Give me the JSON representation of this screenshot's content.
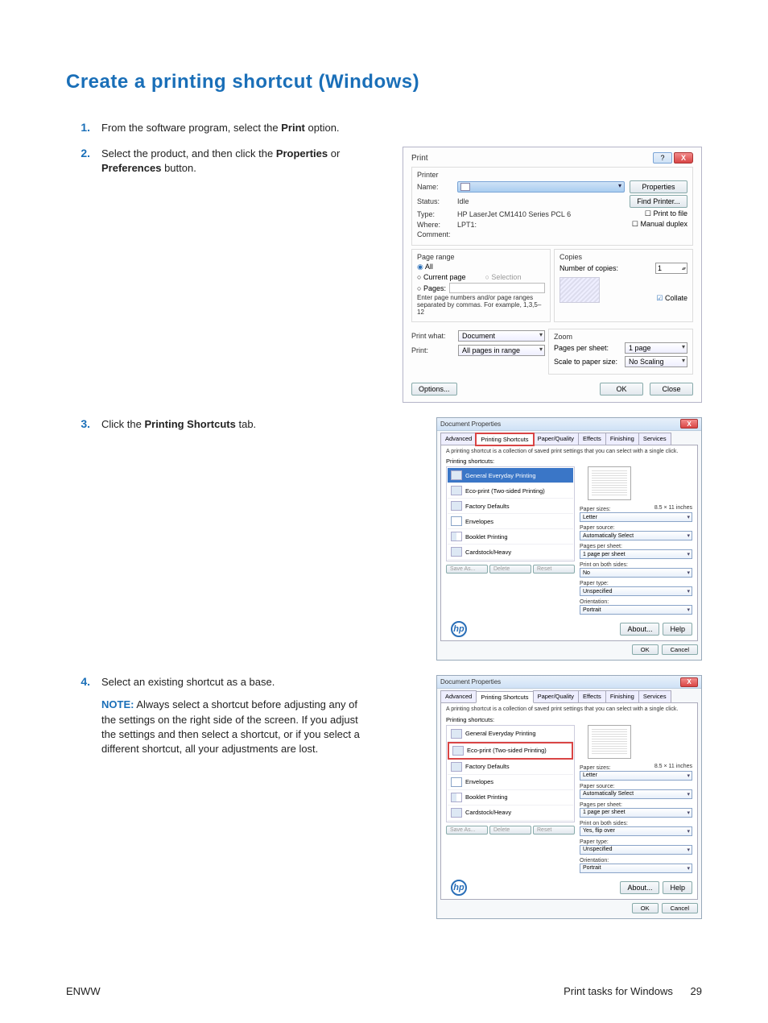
{
  "heading": "Create a printing shortcut (Windows)",
  "steps": {
    "s1": {
      "num": "1.",
      "text_a": "From the software program, select the ",
      "bold_a": "Print",
      "text_b": " option."
    },
    "s2": {
      "num": "2.",
      "text_a": "Select the product, and then click the ",
      "bold_a": "Properties",
      "text_b": " or ",
      "bold_b": "Preferences",
      "text_c": " button."
    },
    "s3": {
      "num": "3.",
      "text_a": "Click the ",
      "bold_a": "Printing Shortcuts",
      "text_b": " tab."
    },
    "s4": {
      "num": "4.",
      "text_a": "Select an existing shortcut as a base."
    },
    "note": {
      "label": "NOTE:",
      "text": " Always select a shortcut before adjusting any of the settings on the right side of the screen. If you adjust the settings and then select a shortcut, or if you select a different shortcut, all your adjustments are lost."
    }
  },
  "print_dialog": {
    "title": "Print",
    "help_btn": "?",
    "close_btn": "X",
    "printer": {
      "group": "Printer",
      "name_label": "Name:",
      "status_label": "Status:",
      "status_value": "Idle",
      "type_label": "Type:",
      "type_value": "HP LaserJet CM1410 Series PCL 6",
      "where_label": "Where:",
      "where_value": "LPT1:",
      "comment_label": "Comment:",
      "properties_btn": "Properties",
      "find_printer_btn": "Find Printer...",
      "print_to_file": "Print to file",
      "manual_duplex": "Manual duplex"
    },
    "page_range": {
      "group": "Page range",
      "all": "All",
      "current_page": "Current page",
      "selection": "Selection",
      "pages": "Pages:",
      "hint": "Enter page numbers and/or page ranges separated by commas.  For example, 1,3,5–12"
    },
    "copies": {
      "group": "Copies",
      "num_label": "Number of copies:",
      "num_value": "1",
      "collate": "Collate"
    },
    "print_what_label": "Print what:",
    "print_what_value": "Document",
    "print_label": "Print:",
    "print_value": "All pages in range",
    "zoom": {
      "group": "Zoom",
      "pps_label": "Pages per sheet:",
      "pps_value": "1 page",
      "scale_label": "Scale to paper size:",
      "scale_value": "No Scaling"
    },
    "options_btn": "Options...",
    "ok_btn": "OK",
    "close2_btn": "Close"
  },
  "doc_props": {
    "title": "Document Properties",
    "close_btn": "X",
    "tabs": [
      "Advanced",
      "Printing Shortcuts",
      "Paper/Quality",
      "Effects",
      "Finishing",
      "Services"
    ],
    "desc": "A printing shortcut is a collection of saved print settings that you can select with a single click.",
    "list_label": "Printing shortcuts:",
    "shortcuts": [
      "General Everyday Printing",
      "Eco-print (Two-sided Printing)",
      "Factory Defaults",
      "Envelopes",
      "Booklet Printing",
      "Cardstock/Heavy"
    ],
    "fields": {
      "paper_sizes": {
        "label": "Paper sizes:",
        "extra": "8.5 × 11 inches",
        "value": "Letter"
      },
      "paper_source": {
        "label": "Paper source:",
        "value": "Automatically Select"
      },
      "pages_per_sheet": {
        "label": "Pages per sheet:",
        "value": "1 page per sheet"
      },
      "print_both_sides": {
        "label": "Print on both sides:",
        "value_a": "No",
        "value_b": "Yes, flip over"
      },
      "paper_type": {
        "label": "Paper type:",
        "value": "Unspecified"
      },
      "orientation": {
        "label": "Orientation:",
        "value": "Portrait"
      }
    },
    "save_as": "Save As...",
    "delete": "Delete",
    "reset": "Reset",
    "about": "About...",
    "help": "Help",
    "ok": "OK",
    "cancel": "Cancel"
  },
  "footer": {
    "left": "ENWW",
    "right": "Print tasks for Windows",
    "page": "29"
  }
}
